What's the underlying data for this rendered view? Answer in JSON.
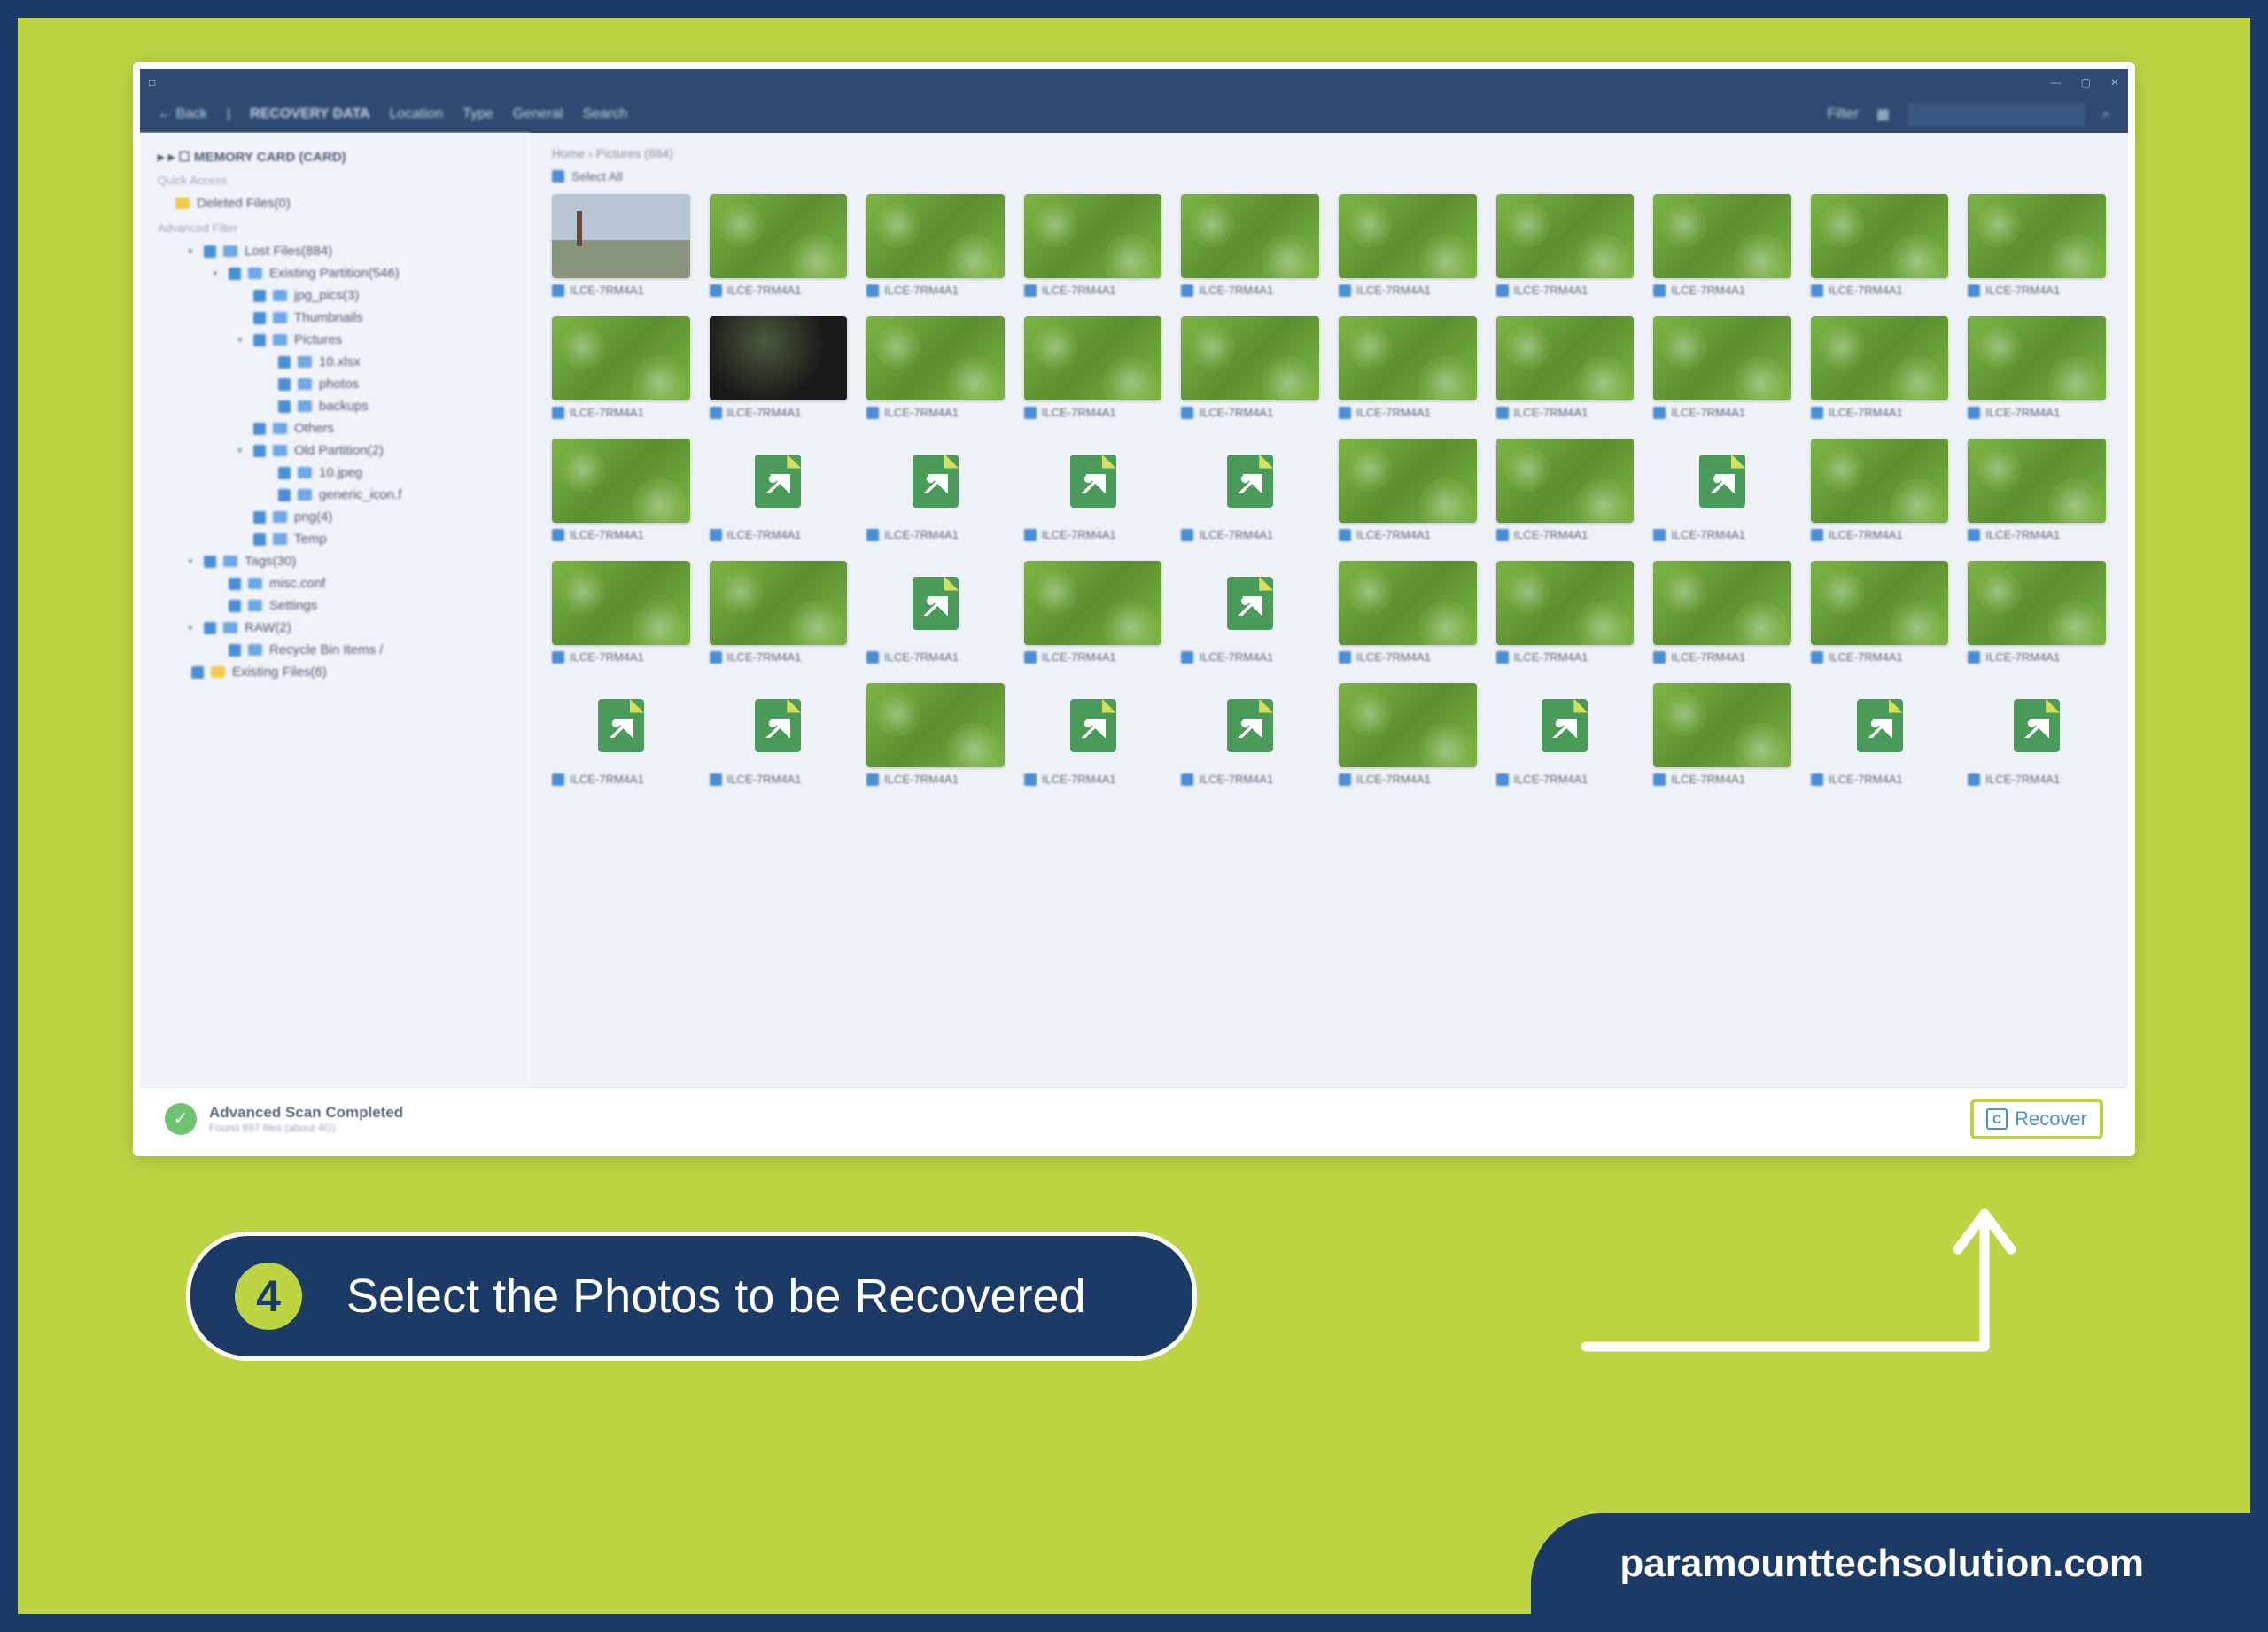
{
  "titlebar": {
    "app_icon": "□"
  },
  "toolbar": {
    "back": "← Back",
    "items": [
      "RECOVERY DATA",
      "Location",
      "Type",
      "General",
      "Search"
    ],
    "filter": "Filter",
    "search_placeholder": ""
  },
  "sidebar": {
    "root": "MEMORY CARD (CARD)",
    "section1": "Quick Access",
    "deleted": "Deleted Files(0)",
    "section2": "Advanced Filter",
    "items": [
      {
        "lvl": 1,
        "label": "Lost Files(884)",
        "caret": "▾"
      },
      {
        "lvl": 2,
        "label": "Existing Partition(546)",
        "caret": "▾"
      },
      {
        "lvl": 3,
        "label": "jpg_pics(3)"
      },
      {
        "lvl": 3,
        "label": "Thumbnails"
      },
      {
        "lvl": 3,
        "label": "Pictures",
        "caret": "▾"
      },
      {
        "lvl": 4,
        "label": "10.xlsx"
      },
      {
        "lvl": 4,
        "label": "photos"
      },
      {
        "lvl": 4,
        "label": "backups"
      },
      {
        "lvl": 3,
        "label": "Others"
      },
      {
        "lvl": 3,
        "label": "Old Partition(2)",
        "caret": "▾"
      },
      {
        "lvl": 4,
        "label": "10.jpeg"
      },
      {
        "lvl": 4,
        "label": "generic_icon.f"
      },
      {
        "lvl": 3,
        "label": "png(4)"
      },
      {
        "lvl": 3,
        "label": "Temp"
      },
      {
        "lvl": 1,
        "label": "Tags(30)",
        "caret": "▾"
      },
      {
        "lvl": 2,
        "label": "misc.conf"
      },
      {
        "lvl": 2,
        "label": "Settings"
      },
      {
        "lvl": 1,
        "label": "RAW(2)",
        "caret": "▾"
      },
      {
        "lvl": 2,
        "label": "Recycle Bin Items /"
      },
      {
        "lvl": 0,
        "label": "Existing Files(6)",
        "fld": "y"
      }
    ]
  },
  "main": {
    "breadcrumb": "Home  ›  Pictures (884)",
    "select_all": "Select All",
    "thumbs": [
      [
        "landscape",
        "leaf",
        "leaf",
        "leaf",
        "leaf",
        "leaf",
        "leaf",
        "leaf",
        "leaf",
        "leaf"
      ],
      [
        "leaf",
        "dark",
        "leaf",
        "leaf",
        "leaf",
        "leaf",
        "leaf",
        "leaf",
        "leaf",
        "leaf"
      ],
      [
        "leaf",
        "placeholder",
        "placeholder",
        "placeholder",
        "placeholder",
        "leaf",
        "leaf",
        "placeholder",
        "leaf",
        "leaf"
      ],
      [
        "leaf",
        "leaf",
        "placeholder",
        "leaf",
        "placeholder",
        "leaf",
        "leaf",
        "leaf",
        "leaf",
        "leaf"
      ],
      [
        "placeholder",
        "placeholder",
        "leaf",
        "placeholder",
        "placeholder",
        "leaf",
        "placeholder",
        "leaf",
        "placeholder",
        "placeholder"
      ]
    ],
    "thumb_label": "ILCE-7RM4A1"
  },
  "status": {
    "title": "Advanced Scan Completed",
    "subtitle": "Found 897 files (about 4G)",
    "recover": "Recover"
  },
  "callout": {
    "step": "4",
    "text": "Select the Photos to be Recovered"
  },
  "footer": "paramounttechsolution.com"
}
